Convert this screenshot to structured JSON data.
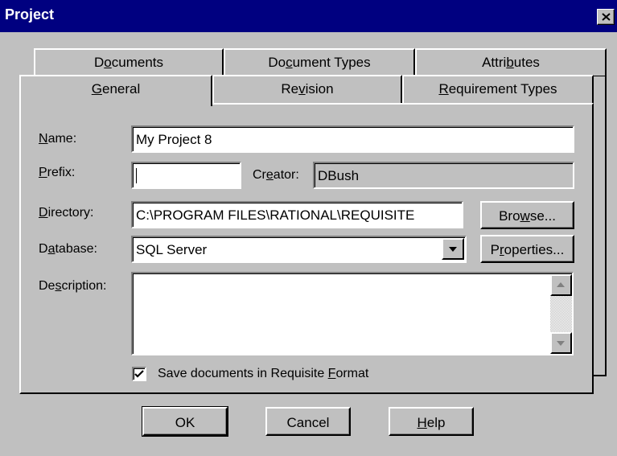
{
  "window": {
    "title": "Project",
    "close_icon": "close-icon"
  },
  "tabs": {
    "back_row": [
      {
        "label": "Documents",
        "underline_index": 1
      },
      {
        "label": "Document Types",
        "underline_index": 1
      },
      {
        "label": "Attributes",
        "underline_index": 5
      }
    ],
    "front_row": [
      {
        "label": "General",
        "underline_index": 0,
        "selected": true
      },
      {
        "label": "Revision",
        "underline_index": 2
      },
      {
        "label": "Requirement Types",
        "underline_index": 0
      }
    ]
  },
  "form": {
    "name_label": "Name:",
    "name_value": "My Project 8",
    "prefix_label": "Prefix:",
    "prefix_value": "",
    "creator_label": "Creator:",
    "creator_value": "DBush",
    "directory_label": "Directory:",
    "directory_value": "C:\\PROGRAM FILES\\RATIONAL\\REQUISITE",
    "browse_label": "Browse...",
    "database_label": "Database:",
    "database_value": "SQL Server",
    "properties_label": "Properties...",
    "description_label": "Description:",
    "description_value": "",
    "save_format_label": "Save documents in Requisite Format",
    "save_format_checked": true
  },
  "buttons": {
    "ok": "OK",
    "cancel": "Cancel",
    "help": "Help"
  }
}
